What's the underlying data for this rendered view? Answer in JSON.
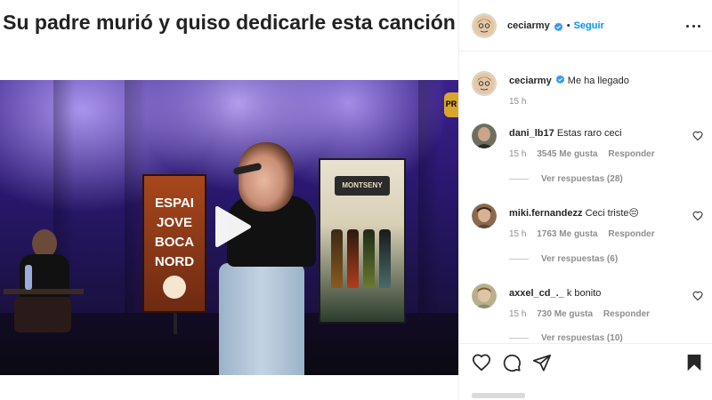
{
  "post": {
    "caption": "Su padre murió y quiso dedicarle esta canción",
    "video_banner_left": "ESPAI JOVE BOCA NORD",
    "video_banner_right": "MONTSENY",
    "video_corner_badge": "PR"
  },
  "header": {
    "username": "ceciarmy",
    "follow_label": "Seguir",
    "separator": "•"
  },
  "comments": [
    {
      "username": "ceciarmy",
      "text": "Me ha llegado",
      "time": "15 h",
      "verified": true,
      "is_caption": true
    },
    {
      "username": "dani_lb17",
      "text": "Estas raro ceci",
      "time": "15 h",
      "likes": "3545 Me gusta",
      "reply_label": "Responder",
      "view_replies": "Ver respuestas (28)"
    },
    {
      "username": "miki.fernandezz",
      "text": "Ceci triste😔",
      "time": "15 h",
      "likes": "1763 Me gusta",
      "reply_label": "Responder",
      "view_replies": "Ver respuestas (6)"
    },
    {
      "username": "axxel_cd_._",
      "text": "k bonito",
      "time": "15 h",
      "likes": "730 Me gusta",
      "reply_label": "Responder",
      "view_replies": "Ver respuestas (10)"
    }
  ],
  "icons": {
    "verified": "verified-badge-icon",
    "more": "more-options-icon",
    "like": "heart-icon",
    "comment": "comment-icon",
    "share": "paper-plane-icon",
    "save": "bookmark-icon",
    "play": "play-icon"
  },
  "colors": {
    "accent": "#0095f6",
    "text": "#262626",
    "muted": "#8e8e8e",
    "border": "#efefef"
  }
}
